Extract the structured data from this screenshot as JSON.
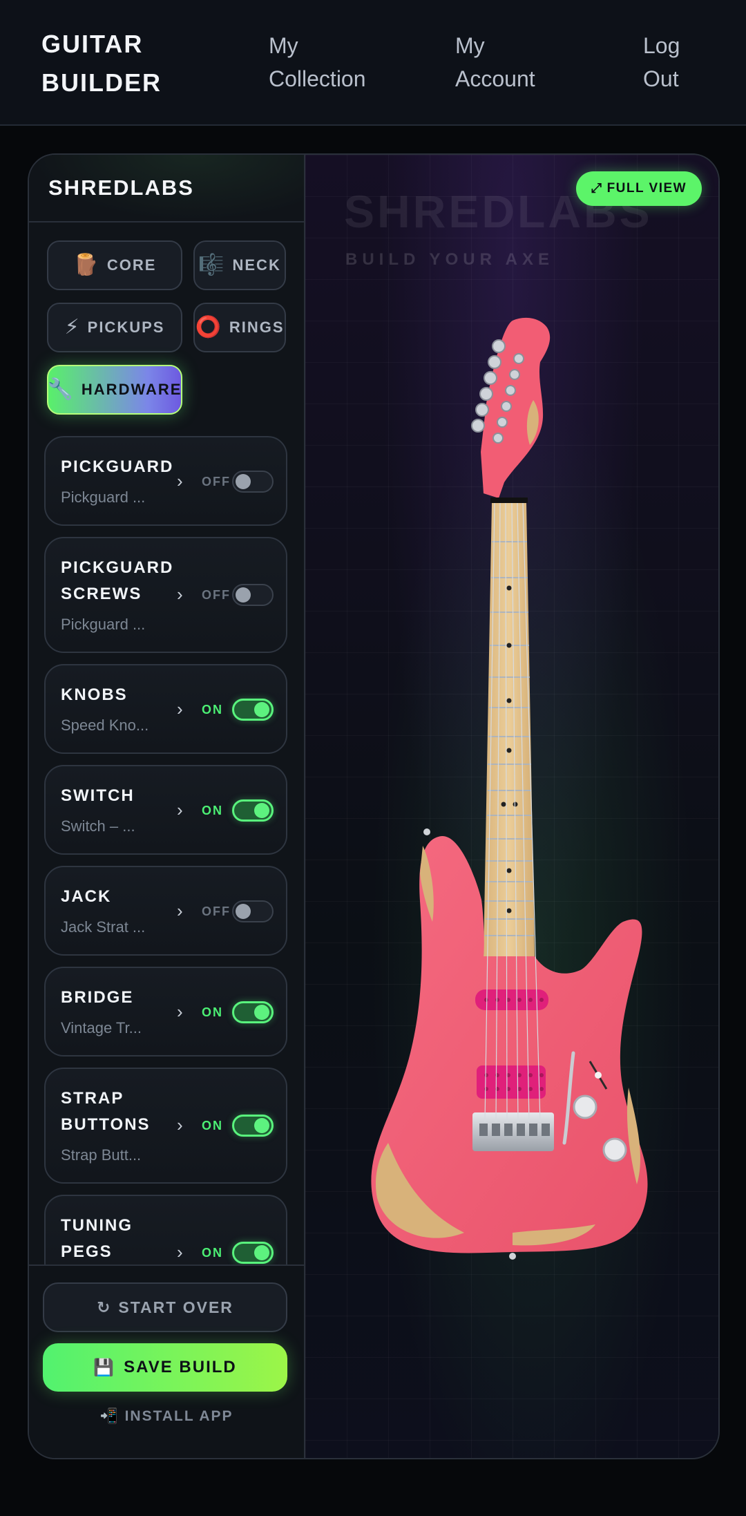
{
  "header": {
    "brand": "GUITAR\nBUILDER",
    "nav": [
      {
        "label": "My\nCollection"
      },
      {
        "label": "My\nAccount"
      },
      {
        "label": "Log\nOut"
      }
    ]
  },
  "sidebar": {
    "title": "SHREDLABS",
    "tabs": [
      {
        "icon": "🪵",
        "icon_name": "wood-log-icon",
        "label": "CORE"
      },
      {
        "icon": "🎼",
        "icon_name": "sheet-music-icon",
        "label": "NECK"
      },
      {
        "icon": "⚡",
        "icon_name": "lightning-icon",
        "label": "PICKUPS"
      },
      {
        "icon": "⭕",
        "icon_name": "ring-icon",
        "label": "RINGS"
      },
      {
        "icon": "🔧",
        "icon_name": "wrench-icon",
        "label": "HARDWARE",
        "active": true
      }
    ],
    "parts": [
      {
        "name": "PICKGUARD",
        "desc": "Pickguard ...",
        "state": "OFF",
        "on": false
      },
      {
        "name": "PICKGUARD SCREWS",
        "desc": "Pickguard ...",
        "state": "OFF",
        "on": false
      },
      {
        "name": "KNOBS",
        "desc": "Speed Kno...",
        "state": "ON",
        "on": true
      },
      {
        "name": "SWITCH",
        "desc": "Switch – ...",
        "state": "ON",
        "on": true
      },
      {
        "name": "JACK",
        "desc": "Jack Strat ...",
        "state": "OFF",
        "on": false
      },
      {
        "name": "BRIDGE",
        "desc": "Vintage Tr...",
        "state": "ON",
        "on": true
      },
      {
        "name": "STRAP BUTTONS",
        "desc": "Strap Butt...",
        "state": "ON",
        "on": true
      },
      {
        "name": "TUNING PEGS",
        "desc": "",
        "state": "ON",
        "on": true
      }
    ],
    "start_over": {
      "icon": "↻",
      "label": "START OVER"
    },
    "save_build": {
      "icon": "💾",
      "label": "SAVE BUILD"
    },
    "install_app": {
      "icon": "📲",
      "label": "INSTALL APP"
    }
  },
  "stage": {
    "watermark_title": "SHREDLABS",
    "watermark_subtitle": "BUILD YOUR AXE",
    "full_view": {
      "icon": "⤢",
      "label": "FULL VIEW"
    },
    "colors": {
      "body": "#f25d74",
      "body_shadow": "#c43c55",
      "wood": "#d8b27a",
      "fretboard": "#e3c28c",
      "pickup": "#e0207a",
      "accent": "#5cf469"
    }
  }
}
